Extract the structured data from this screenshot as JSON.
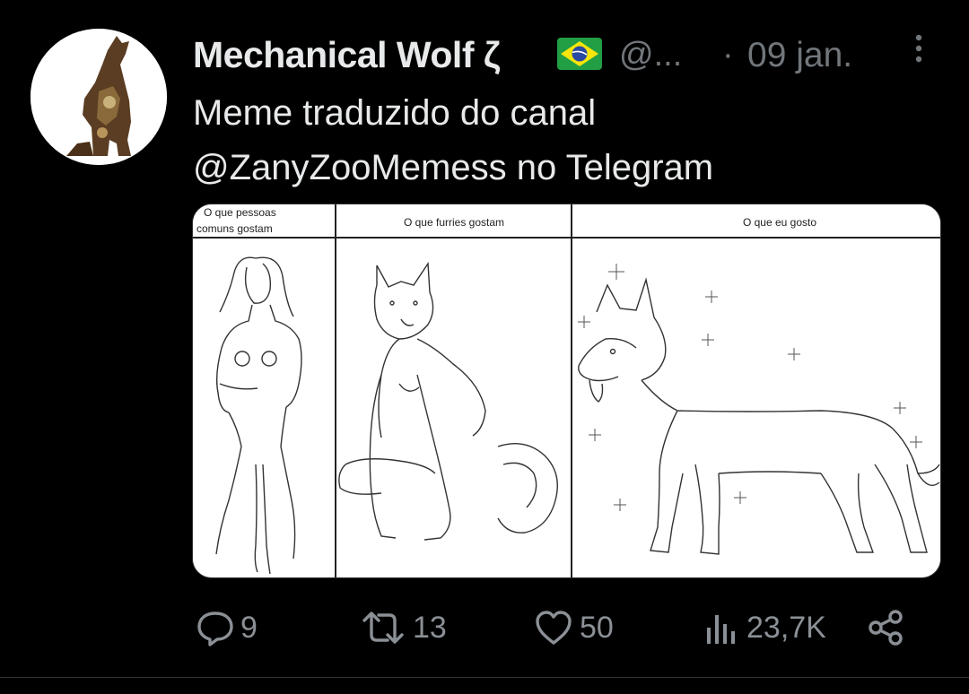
{
  "author": {
    "display_name": "Mechanical Wolf ζ",
    "flag_icon": "brazil-flag-icon",
    "handle": "@...",
    "separator": "·",
    "date": "09 jan."
  },
  "tweet": {
    "lines": [
      "Meme traduzido do canal",
      "@ZanyZooMemess no Telegram"
    ]
  },
  "media": {
    "panels": [
      {
        "caption_lines": [
          "O que pessoas",
          "comuns gostam"
        ]
      },
      {
        "caption": "O que furries gostam"
      },
      {
        "caption": "O que eu gosto"
      }
    ]
  },
  "actions": {
    "reply": {
      "icon": "reply-icon",
      "count": "9"
    },
    "retweet": {
      "icon": "retweet-icon",
      "count": "13"
    },
    "like": {
      "icon": "heart-icon",
      "count": "50"
    },
    "views": {
      "icon": "views-icon",
      "count": "23,7K"
    },
    "share": {
      "icon": "share-icon"
    }
  },
  "colors": {
    "background": "#000000",
    "text": "#e7e9ea",
    "secondary": "#71767b",
    "flag_green": "#229e45",
    "flag_yellow": "#f8e509",
    "flag_blue": "#2b49a3"
  }
}
